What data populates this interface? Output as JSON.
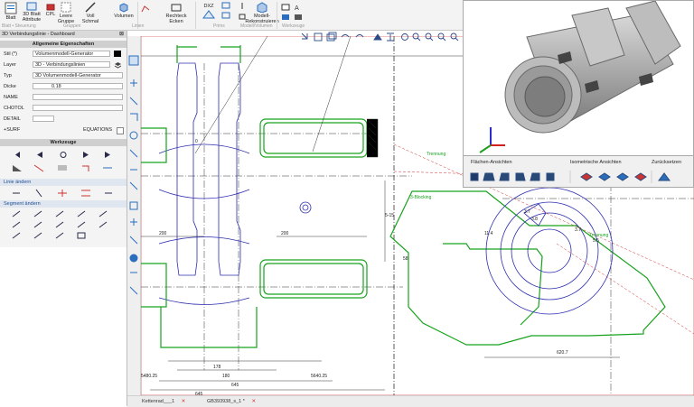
{
  "ribbon": {
    "buttons": [
      {
        "label": "Blatt"
      },
      {
        "label": "3D Blatt Attribute"
      },
      {
        "label": "CPL"
      },
      {
        "label": "Leere Gruppe"
      },
      {
        "label": "Voll Schmal"
      },
      {
        "label": "Volumen"
      },
      {
        "label": "Rechteck Ecken"
      },
      {
        "label": "DXZ"
      },
      {
        "label": "Modell-Rekonstruieren"
      }
    ],
    "groups": [
      "Blatt • Steuerung",
      "Gruppen",
      "Linien",
      "Prims",
      "Modell/Volumen",
      "Werkzeuge"
    ]
  },
  "left_panel": {
    "title": "3D Verbindungslinie - Dashboard",
    "section_general": "Allgemeine Eigenschaften",
    "fields": [
      {
        "label": "Stil (*)",
        "value": "Volumenmodell-Generator"
      },
      {
        "label": "Layer",
        "value": "3D - Verbindungslinien"
      },
      {
        "label": "Typ",
        "value": "3D Volumenmodell-Generator"
      },
      {
        "label": "Dicke",
        "value": "0.18"
      },
      {
        "label": "NAME",
        "value": ""
      },
      {
        "label": "CHOTOL",
        "value": ""
      },
      {
        "label": "DETAIL",
        "value": ""
      }
    ],
    "surf_label": "+SURF",
    "equations_label": "EQUATIONS",
    "section_tools": "Werkzeuge",
    "section_line": "Linie ändern",
    "section_segment": "Segment ändern"
  },
  "view3d": {
    "label_faces": "Flächen-Ansichten",
    "label_iso": "Isometrische Ansichten",
    "label_reset": "Zurücksetzen"
  },
  "drawing": {
    "dims": [
      "0",
      "200",
      "200",
      "178",
      "180",
      "5-15",
      "645",
      "645",
      "5640.25",
      "5480.25",
      "5480.25",
      "5480.25",
      "5480.25",
      "5480.25",
      "620.7",
      "11.4",
      "3.7",
      "3.8",
      "5.5",
      "58",
      "3.7"
    ],
    "labels": [
      "Trennung",
      "Trennung",
      "3-Blocking"
    ]
  },
  "tabs": [
    {
      "label": "Kettenrad___1"
    },
    {
      "label": "GB393938_s_1 *"
    }
  ],
  "colors": {
    "accent": "#2a6ebd",
    "green": "#17a21d",
    "blue": "#2c2cb0",
    "red": "#d03030",
    "dark": "#303030"
  }
}
